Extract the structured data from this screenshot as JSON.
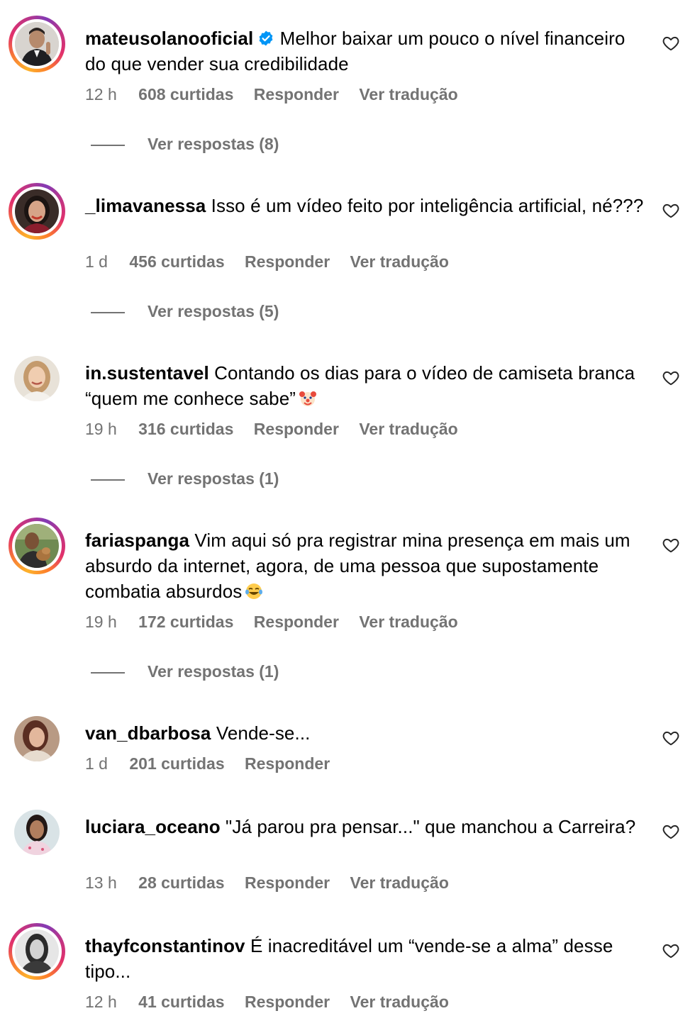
{
  "comments": [
    {
      "username": "mateusolanooficial",
      "verified": true,
      "text": "Melhor baixar um pouco o nível financeiro do que vender sua credibilidade",
      "time": "12 h",
      "likes": "608 curtidas",
      "reply": "Responder",
      "translate": "Ver tradução",
      "view_replies": "Ver respostas (8)"
    },
    {
      "username": "_limavanessa",
      "text": "Isso é um vídeo feito por inteligência artificial, né???",
      "time": "1 d",
      "likes": "456 curtidas",
      "reply": "Responder",
      "translate": "Ver tradução",
      "view_replies": "Ver respostas (5)"
    },
    {
      "username": "in.sustentavel",
      "text": "Contando os dias para o vídeo de camiseta branca “quem me conhece sabe”",
      "emoji": "clown-face-emoji",
      "time": "19 h",
      "likes": "316 curtidas",
      "reply": "Responder",
      "translate": "Ver tradução",
      "view_replies": "Ver respostas (1)"
    },
    {
      "username": "fariaspanga",
      "text": "Vim aqui só pra registrar mina presença em mais um absurdo da internet, agora, de uma pessoa que supostamente combatia absurdos",
      "emoji": "laughing-tears-emoji",
      "time": "19 h",
      "likes": "172 curtidas",
      "reply": "Responder",
      "translate": "Ver tradução",
      "view_replies": "Ver respostas (1)"
    },
    {
      "username": "van_dbarbosa",
      "text": "Vende-se...",
      "time": "1 d",
      "likes": "201 curtidas",
      "reply": "Responder"
    },
    {
      "username": "luciara_oceano",
      "text": "\"Já parou pra pensar...\" que manchou a Carreira?",
      "time": "13 h",
      "likes": "28 curtidas",
      "reply": "Responder",
      "translate": "Ver tradução"
    },
    {
      "username": "thayfconstantinov",
      "text": "É inacreditável um “vende-se a alma” desse tipo...",
      "time": "12 h",
      "likes": "41 curtidas",
      "reply": "Responder",
      "translate": "Ver tradução"
    }
  ],
  "colors": {
    "meta_text": "#737373",
    "verified_badge": "#0095f6",
    "story_ring": "#e1306c"
  }
}
